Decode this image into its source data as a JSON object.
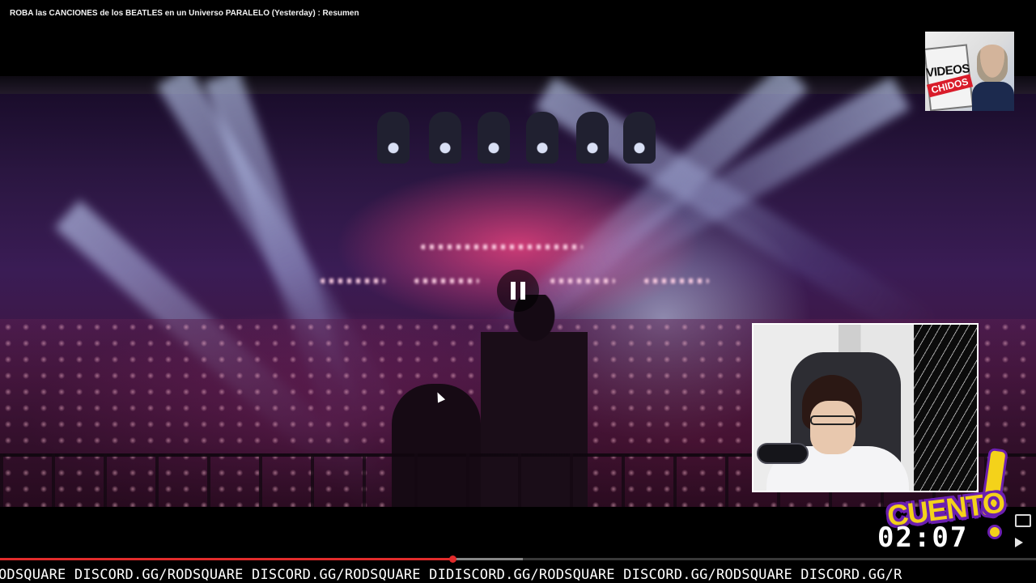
{
  "player": {
    "title": "ROBA las CANCIONES de los BEATLES en un Universo PARALELO (Yesterday) : Resumen",
    "state": "playing",
    "progress_fraction": 0.437,
    "buffered_fraction": 0.505
  },
  "overlays": {
    "topright_cam": {
      "sign_top": "VIDEOS",
      "sign_bottom": "CHIDOS"
    },
    "sticker_text": "CUENTO",
    "timer": "02:07",
    "ticker": "ODSQUARE DISCORD.GG/RODSQUARE DISCORD.GG/RODSQUARE DIDISCORD.GG/RODSQUARE DISCORD.GG/RODSQUARE DISCORD.GG/R"
  },
  "icons": {
    "pause": "pause-icon",
    "share": "share-icon",
    "miniplayer": "miniplayer-icon"
  },
  "colors": {
    "progress_played": "#e22b2b",
    "sticker_yellow": "#f4d21a",
    "sticker_purple": "#6b1fb0"
  }
}
